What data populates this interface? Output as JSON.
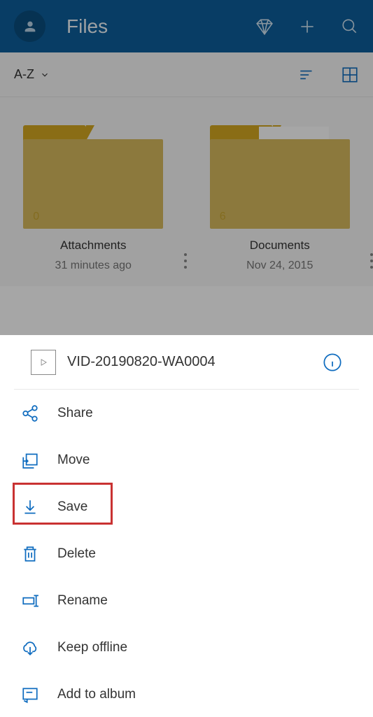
{
  "header": {
    "title": "Files"
  },
  "toolbar": {
    "sort_label": "A-Z"
  },
  "folders": [
    {
      "name": "Attachments",
      "meta": "31 minutes ago",
      "count": "0",
      "has_paper": false
    },
    {
      "name": "Documents",
      "meta": "Nov 24, 2015",
      "count": "6",
      "has_paper": true
    }
  ],
  "sheet": {
    "title": "VID-20190820-WA0004",
    "items": {
      "share": "Share",
      "move": "Move",
      "save": "Save",
      "delete": "Delete",
      "rename": "Rename",
      "keep_offline": "Keep offline",
      "add_to_album": "Add to album"
    }
  }
}
